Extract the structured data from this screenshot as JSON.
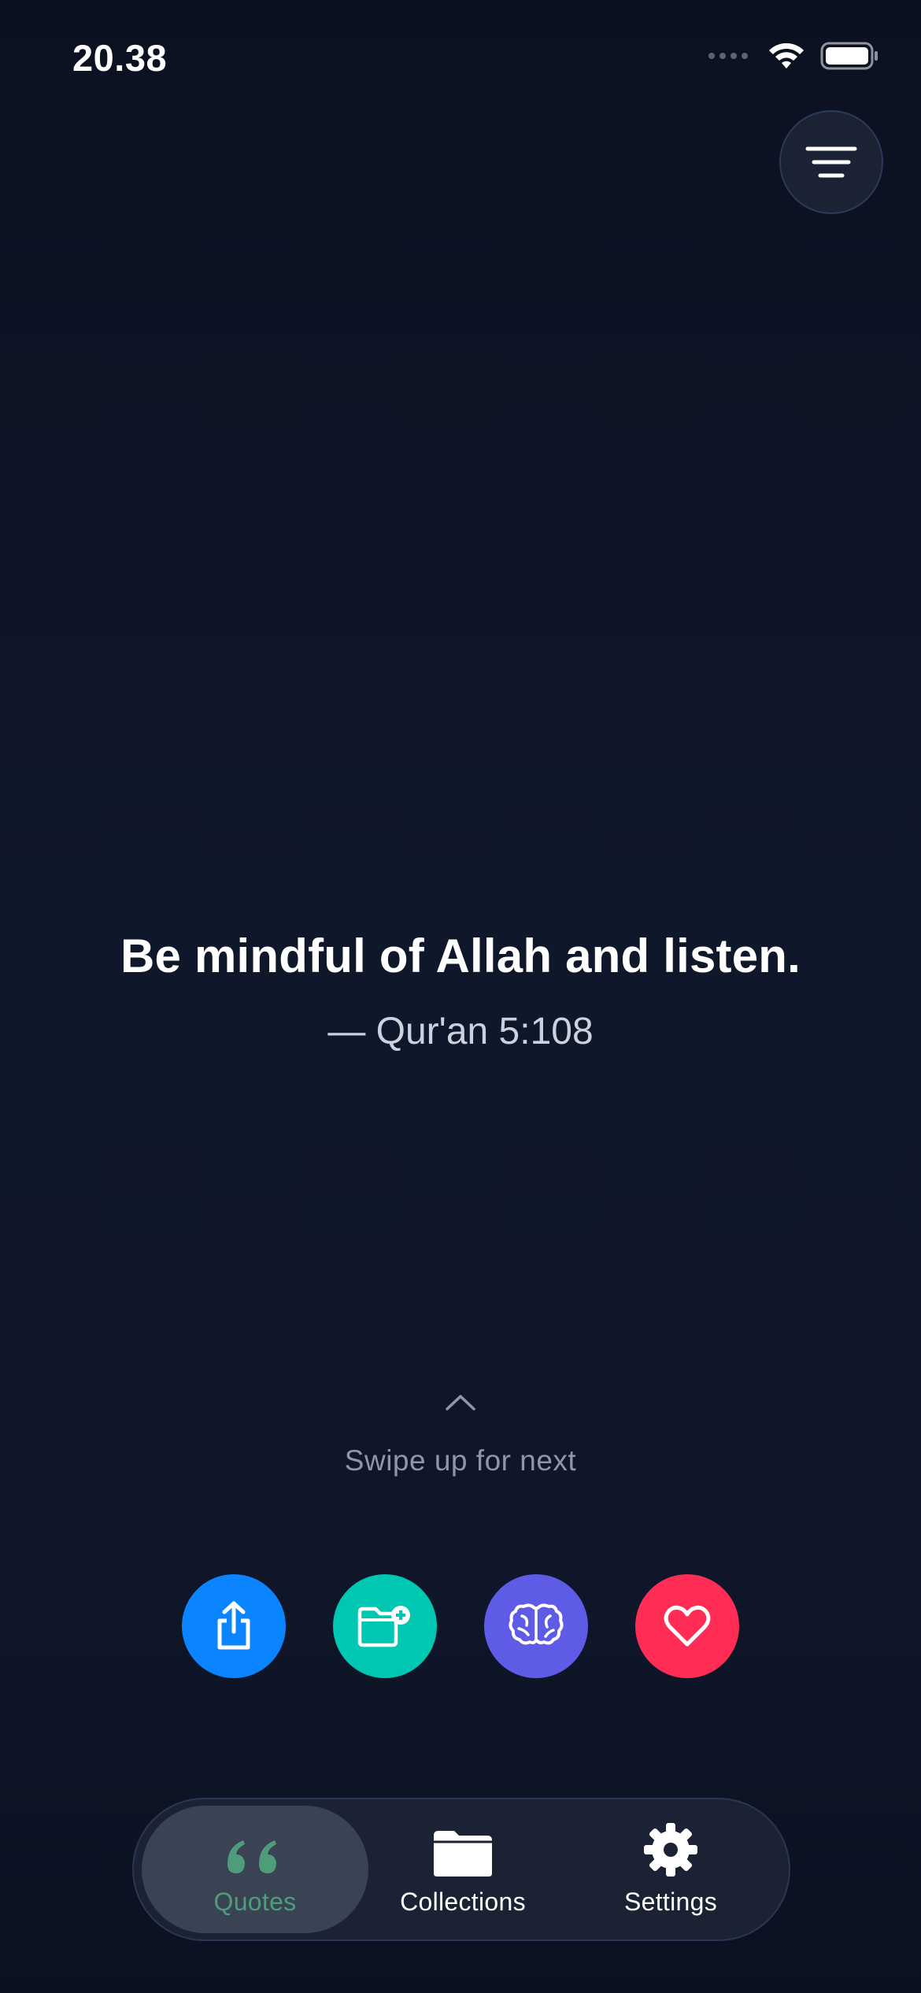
{
  "status_bar": {
    "time": "20.38"
  },
  "header": {
    "menu_icon": "filter-lines-icon"
  },
  "quote": {
    "text": "Be mindful of Allah and listen.",
    "source": "— Qur'an 5:108"
  },
  "swipe": {
    "hint": "Swipe up for next",
    "icon": "chevron-up-icon"
  },
  "actions": [
    {
      "icon": "share-icon",
      "color": "#0a84ff"
    },
    {
      "icon": "folder-add-icon",
      "color": "#00c7b1"
    },
    {
      "icon": "brain-icon",
      "color": "#5e5ce6"
    },
    {
      "icon": "heart-icon",
      "color": "#ff2d55"
    }
  ],
  "tabbar": {
    "active": "quotes",
    "tabs": [
      {
        "id": "quotes",
        "label": "Quotes",
        "icon": "quote-icon"
      },
      {
        "id": "collections",
        "label": "Collections",
        "icon": "folder-icon"
      },
      {
        "id": "settings",
        "label": "Settings",
        "icon": "gear-icon"
      }
    ]
  },
  "colors": {
    "active_tab": "#4f9c7a",
    "background": "#0f172a"
  }
}
